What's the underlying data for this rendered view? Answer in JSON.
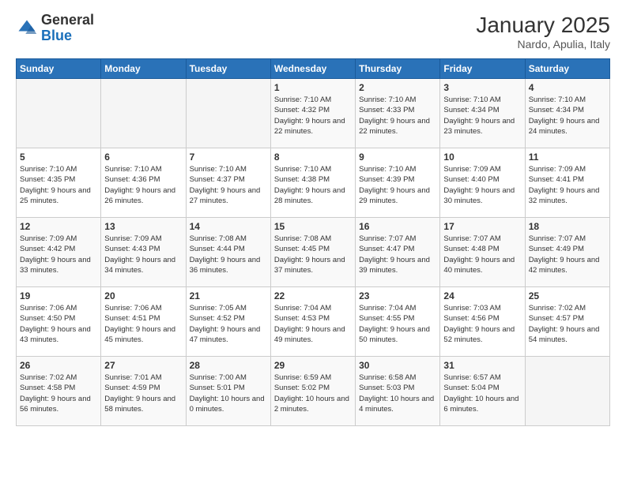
{
  "logo": {
    "general": "General",
    "blue": "Blue"
  },
  "header": {
    "month": "January 2025",
    "location": "Nardo, Apulia, Italy"
  },
  "weekdays": [
    "Sunday",
    "Monday",
    "Tuesday",
    "Wednesday",
    "Thursday",
    "Friday",
    "Saturday"
  ],
  "weeks": [
    [
      {
        "day": "",
        "info": ""
      },
      {
        "day": "",
        "info": ""
      },
      {
        "day": "",
        "info": ""
      },
      {
        "day": "1",
        "info": "Sunrise: 7:10 AM\nSunset: 4:32 PM\nDaylight: 9 hours and 22 minutes."
      },
      {
        "day": "2",
        "info": "Sunrise: 7:10 AM\nSunset: 4:33 PM\nDaylight: 9 hours and 22 minutes."
      },
      {
        "day": "3",
        "info": "Sunrise: 7:10 AM\nSunset: 4:34 PM\nDaylight: 9 hours and 23 minutes."
      },
      {
        "day": "4",
        "info": "Sunrise: 7:10 AM\nSunset: 4:34 PM\nDaylight: 9 hours and 24 minutes."
      }
    ],
    [
      {
        "day": "5",
        "info": "Sunrise: 7:10 AM\nSunset: 4:35 PM\nDaylight: 9 hours and 25 minutes."
      },
      {
        "day": "6",
        "info": "Sunrise: 7:10 AM\nSunset: 4:36 PM\nDaylight: 9 hours and 26 minutes."
      },
      {
        "day": "7",
        "info": "Sunrise: 7:10 AM\nSunset: 4:37 PM\nDaylight: 9 hours and 27 minutes."
      },
      {
        "day": "8",
        "info": "Sunrise: 7:10 AM\nSunset: 4:38 PM\nDaylight: 9 hours and 28 minutes."
      },
      {
        "day": "9",
        "info": "Sunrise: 7:10 AM\nSunset: 4:39 PM\nDaylight: 9 hours and 29 minutes."
      },
      {
        "day": "10",
        "info": "Sunrise: 7:09 AM\nSunset: 4:40 PM\nDaylight: 9 hours and 30 minutes."
      },
      {
        "day": "11",
        "info": "Sunrise: 7:09 AM\nSunset: 4:41 PM\nDaylight: 9 hours and 32 minutes."
      }
    ],
    [
      {
        "day": "12",
        "info": "Sunrise: 7:09 AM\nSunset: 4:42 PM\nDaylight: 9 hours and 33 minutes."
      },
      {
        "day": "13",
        "info": "Sunrise: 7:09 AM\nSunset: 4:43 PM\nDaylight: 9 hours and 34 minutes."
      },
      {
        "day": "14",
        "info": "Sunrise: 7:08 AM\nSunset: 4:44 PM\nDaylight: 9 hours and 36 minutes."
      },
      {
        "day": "15",
        "info": "Sunrise: 7:08 AM\nSunset: 4:45 PM\nDaylight: 9 hours and 37 minutes."
      },
      {
        "day": "16",
        "info": "Sunrise: 7:07 AM\nSunset: 4:47 PM\nDaylight: 9 hours and 39 minutes."
      },
      {
        "day": "17",
        "info": "Sunrise: 7:07 AM\nSunset: 4:48 PM\nDaylight: 9 hours and 40 minutes."
      },
      {
        "day": "18",
        "info": "Sunrise: 7:07 AM\nSunset: 4:49 PM\nDaylight: 9 hours and 42 minutes."
      }
    ],
    [
      {
        "day": "19",
        "info": "Sunrise: 7:06 AM\nSunset: 4:50 PM\nDaylight: 9 hours and 43 minutes."
      },
      {
        "day": "20",
        "info": "Sunrise: 7:06 AM\nSunset: 4:51 PM\nDaylight: 9 hours and 45 minutes."
      },
      {
        "day": "21",
        "info": "Sunrise: 7:05 AM\nSunset: 4:52 PM\nDaylight: 9 hours and 47 minutes."
      },
      {
        "day": "22",
        "info": "Sunrise: 7:04 AM\nSunset: 4:53 PM\nDaylight: 9 hours and 49 minutes."
      },
      {
        "day": "23",
        "info": "Sunrise: 7:04 AM\nSunset: 4:55 PM\nDaylight: 9 hours and 50 minutes."
      },
      {
        "day": "24",
        "info": "Sunrise: 7:03 AM\nSunset: 4:56 PM\nDaylight: 9 hours and 52 minutes."
      },
      {
        "day": "25",
        "info": "Sunrise: 7:02 AM\nSunset: 4:57 PM\nDaylight: 9 hours and 54 minutes."
      }
    ],
    [
      {
        "day": "26",
        "info": "Sunrise: 7:02 AM\nSunset: 4:58 PM\nDaylight: 9 hours and 56 minutes."
      },
      {
        "day": "27",
        "info": "Sunrise: 7:01 AM\nSunset: 4:59 PM\nDaylight: 9 hours and 58 minutes."
      },
      {
        "day": "28",
        "info": "Sunrise: 7:00 AM\nSunset: 5:01 PM\nDaylight: 10 hours and 0 minutes."
      },
      {
        "day": "29",
        "info": "Sunrise: 6:59 AM\nSunset: 5:02 PM\nDaylight: 10 hours and 2 minutes."
      },
      {
        "day": "30",
        "info": "Sunrise: 6:58 AM\nSunset: 5:03 PM\nDaylight: 10 hours and 4 minutes."
      },
      {
        "day": "31",
        "info": "Sunrise: 6:57 AM\nSunset: 5:04 PM\nDaylight: 10 hours and 6 minutes."
      },
      {
        "day": "",
        "info": ""
      }
    ]
  ]
}
